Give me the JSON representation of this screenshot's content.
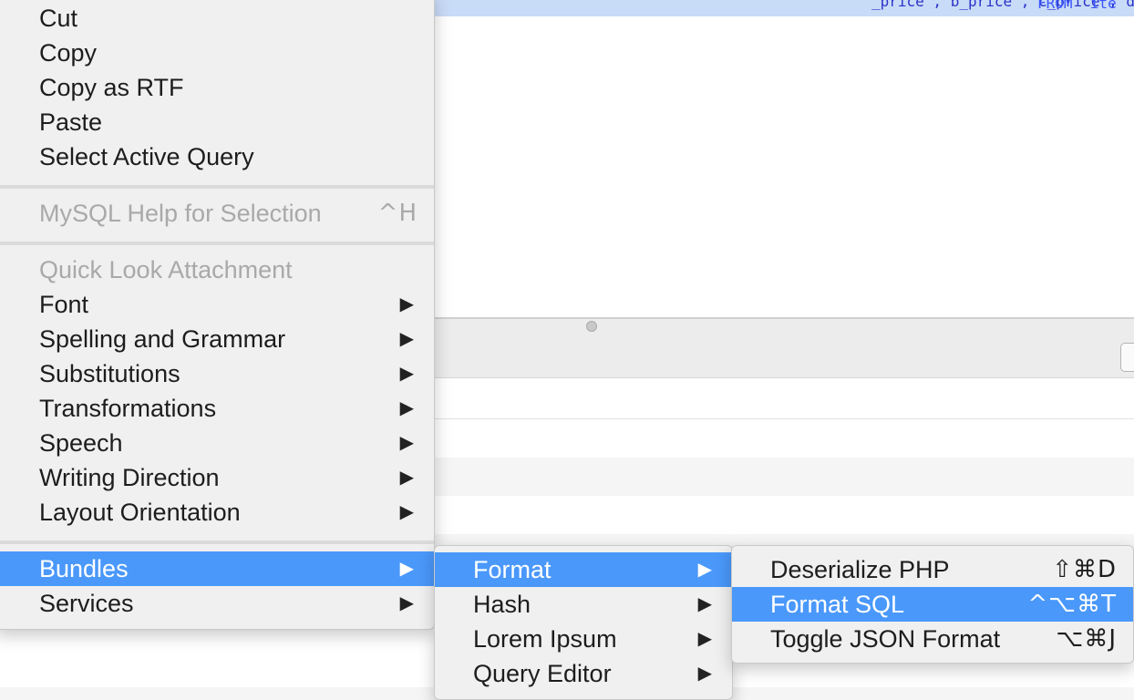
{
  "editor": {
    "query_fragment": "_price , b_price , c_price , d_size , b_size , c_size ,",
    "keyword_fragment": "FROM `ite"
  },
  "context_menu": {
    "edit_items": [
      "Cut",
      "Copy",
      "Copy as RTF",
      "Paste",
      "Select Active Query"
    ],
    "help_item": {
      "label": "MySQL Help for Selection",
      "shortcut": "^H"
    },
    "quick_look": "Quick Look Attachment",
    "submenu_items": [
      "Font",
      "Spelling and Grammar",
      "Substitutions",
      "Transformations",
      "Speech",
      "Writing Direction",
      "Layout Orientation"
    ],
    "bundles": "Bundles",
    "services": "Services"
  },
  "bundles_menu": {
    "items": [
      "Format",
      "Hash",
      "Lorem Ipsum",
      "Query Editor"
    ]
  },
  "format_menu": {
    "items": [
      {
        "label": "Deserialize PHP",
        "shortcut": "⇧⌘D"
      },
      {
        "label": "Format SQL",
        "shortcut": "^⌥⌘T"
      },
      {
        "label": "Toggle JSON Format",
        "shortcut": "⌥⌘J"
      }
    ]
  },
  "colors": {
    "selection": "#4a98fa",
    "menu_bg": "#f0f0f0",
    "disabled_text": "#a9a9a9",
    "sql_highlight": "#c8dbf7"
  },
  "icons": [
    "submenu-arrow-icon"
  ]
}
